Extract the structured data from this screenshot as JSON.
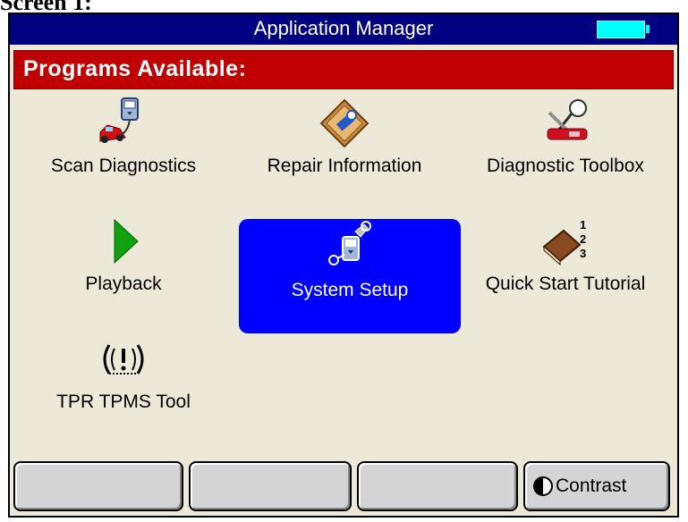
{
  "caption": "Screen 1:",
  "window": {
    "title": "Application Manager",
    "battery_icon": "battery-full-icon",
    "battery_color": "#00ffff"
  },
  "header": {
    "label": "Programs Available:",
    "color": "#c00000"
  },
  "programs": [
    {
      "label": "Scan Diagnostics",
      "icon": "scan-diagnostics-icon"
    },
    {
      "label": "Repair Information",
      "icon": "repair-information-icon"
    },
    {
      "label": "Diagnostic Toolbox",
      "icon": "diagnostic-toolbox-icon"
    },
    {
      "label": "Playback",
      "icon": "playback-icon"
    },
    {
      "label": "System Setup",
      "icon": "system-setup-icon",
      "selected": true
    },
    {
      "label": "Quick Start Tutorial",
      "icon": "quick-start-tutorial-icon"
    },
    {
      "label": "TPR TPMS Tool",
      "icon": "tpms-tool-icon"
    }
  ],
  "softkeys": [
    {
      "label": ""
    },
    {
      "label": ""
    },
    {
      "label": ""
    },
    {
      "label": "Contrast",
      "icon": "contrast-icon"
    }
  ],
  "colors": {
    "titlebar": "#000080",
    "selection": "#0000ff",
    "background": "#ece9d8"
  }
}
